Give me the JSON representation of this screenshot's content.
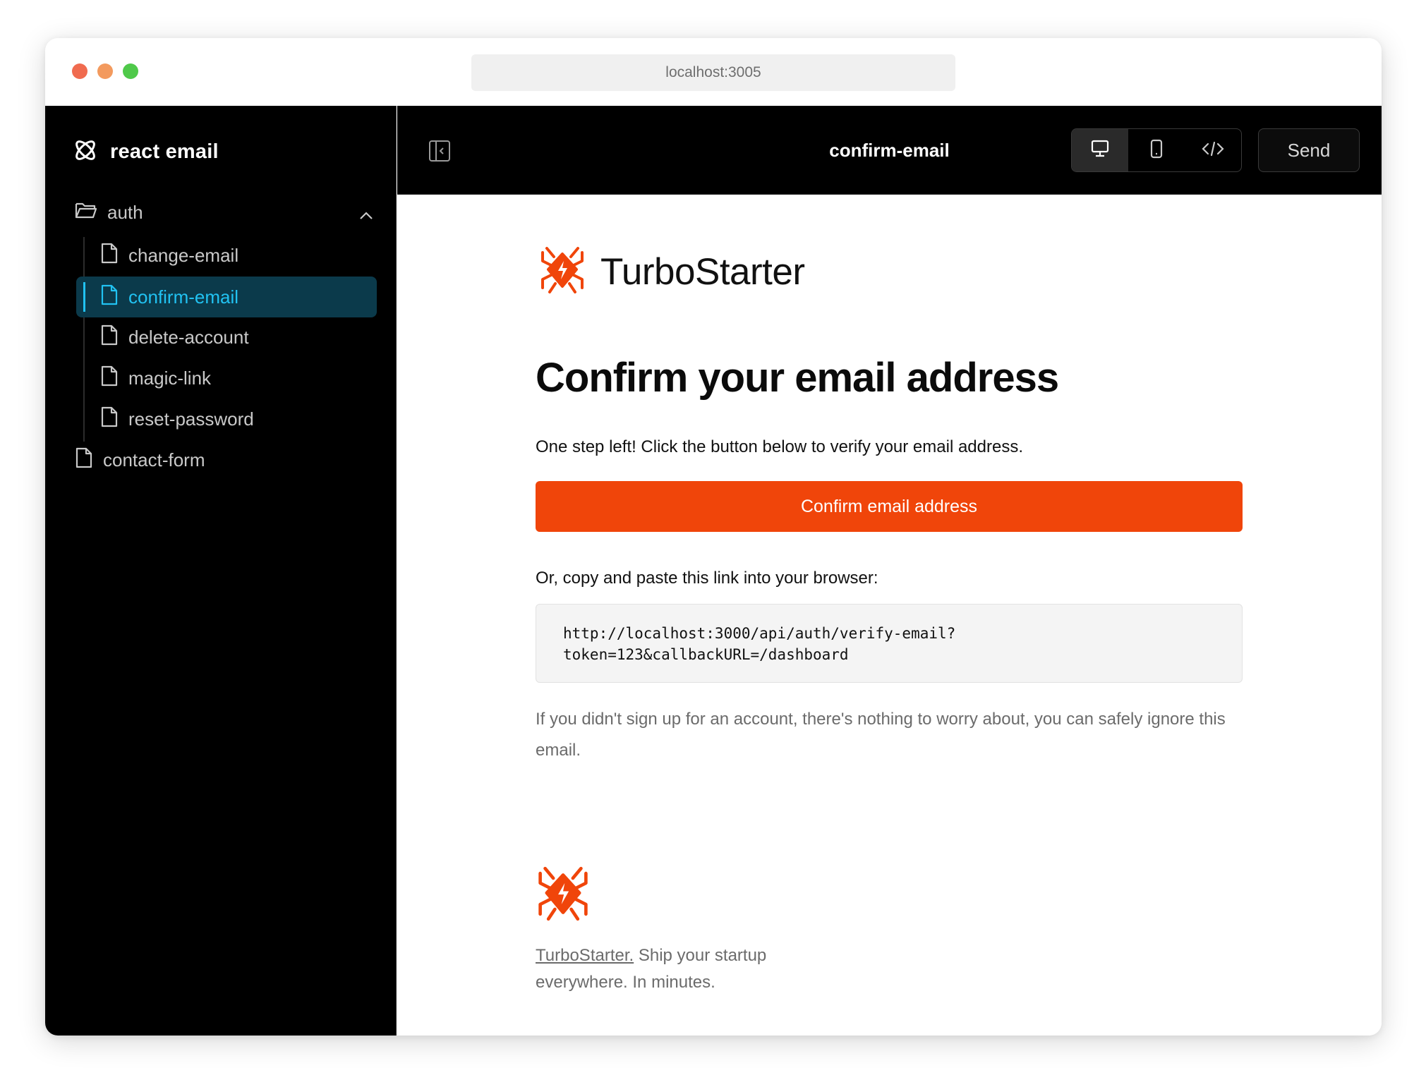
{
  "browser": {
    "url": "localhost:3005"
  },
  "sidebar": {
    "brand": "react email",
    "folder": {
      "label": "auth"
    },
    "items": [
      {
        "label": "change-email"
      },
      {
        "label": "confirm-email"
      },
      {
        "label": "delete-account"
      },
      {
        "label": "magic-link"
      },
      {
        "label": "reset-password"
      }
    ],
    "root_items": [
      {
        "label": "contact-form"
      }
    ]
  },
  "topbar": {
    "title": "confirm-email",
    "send_label": "Send",
    "view_modes": [
      "desktop-icon",
      "mobile-icon",
      "code-icon"
    ],
    "active_view": "desktop"
  },
  "email": {
    "brand_name": "TurboStarter",
    "heading": "Confirm your email address",
    "intro": "One step left! Click the button below to verify your email address.",
    "cta_label": "Confirm email address",
    "copy_label": "Or, copy and paste this link into your browser:",
    "link_line1": "http://localhost:3000/api/auth/verify-email?",
    "link_line2": "token=123&callbackURL=/dashboard",
    "disclaimer": "If you didn't sign up for an account, there's nothing to worry about, you can safely ignore this email.",
    "footer_link": "TurboStarter.",
    "footer_text_1": " Ship your startup",
    "footer_text_2": "everywhere. In minutes."
  },
  "colors": {
    "accent": "#f0450a",
    "sidebar_active_bg": "#0b3a4b",
    "sidebar_active_text": "#21c2f2"
  }
}
